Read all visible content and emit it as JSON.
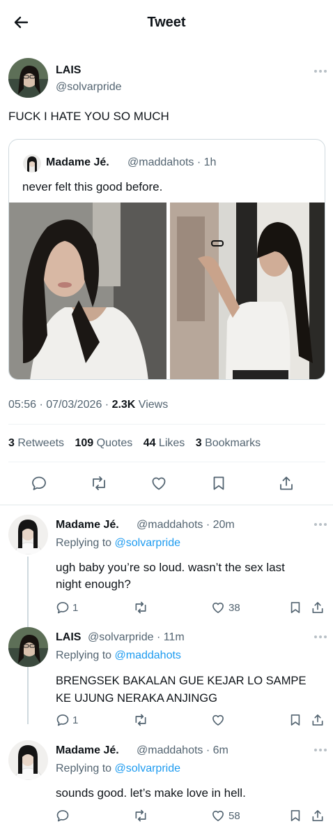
{
  "header": {
    "title": "Tweet"
  },
  "main_tweet": {
    "author_name": "LAIS",
    "author_handle": "@solvarpride",
    "text": "FUCK I HATE YOU SO MUCH",
    "quoted": {
      "author_name": "Madame Jé.",
      "author_handle": "@maddahots",
      "time": "· 1h",
      "text": "never felt this good before."
    },
    "timestamp": "05:56 · 07/03/2026 · ",
    "views_count": "2.3K",
    "views_label": " Views",
    "stats": {
      "retweets_count": "3",
      "retweets_label": " Retweets",
      "quotes_count": "109",
      "quotes_label": " Quotes",
      "likes_count": "44",
      "likes_label": " Likes",
      "bookmarks_count": "3",
      "bookmarks_label": " Bookmarks"
    }
  },
  "replies": [
    {
      "author_name": "Madame Jé.",
      "author_handle": "@maddahots · 20m",
      "replying_label": "Replying to ",
      "replying_to": "@solvarpride",
      "text_line1": "ugh baby you’re so loud. wasn’t the sex last",
      "text_line2": "night enough?",
      "reply_count": "1",
      "like_count": "38"
    },
    {
      "author_name": "LAIS",
      "author_handle": "@solvarpride · 11m",
      "replying_label": "Replying to ",
      "replying_to": "@maddahots",
      "text_line1": "BRENGSEK BAKALAN GUE KEJAR LO SAMPE",
      "text_line2": "KE UJUNG NERAKA ANJINGG",
      "reply_count": "1",
      "like_count": ""
    },
    {
      "author_name": "Madame Jé.",
      "author_handle": "@maddahots · 6m",
      "replying_label": "Replying to ",
      "replying_to": "@solvarpride",
      "text_line1": "sounds good. let’s make love in hell.",
      "text_line2": "",
      "reply_count": "",
      "like_count": "58"
    }
  ],
  "colors": {
    "accent": "#1d9bf0",
    "muted": "#536471",
    "text": "#0f1419",
    "divider": "#eff3f4"
  },
  "icons": [
    "back-arrow-icon",
    "more-icon",
    "reply-icon",
    "retweet-icon",
    "like-icon",
    "bookmark-icon",
    "share-icon"
  ]
}
